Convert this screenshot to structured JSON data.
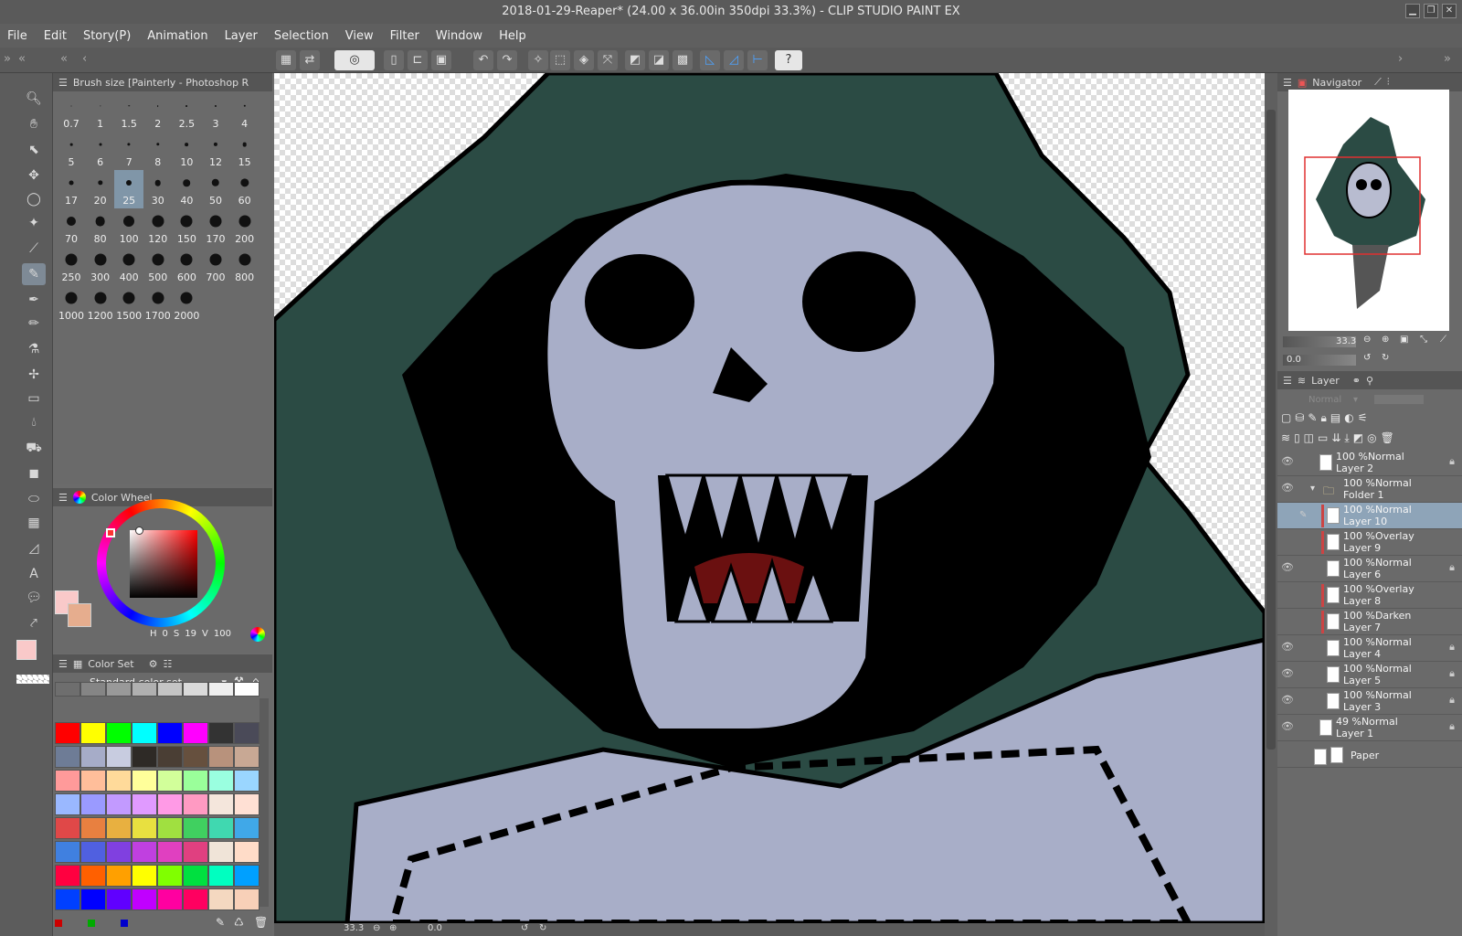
{
  "window": {
    "title": "2018-01-29-Reaper* (24.00 x 36.00in 350dpi 33.3%) - CLIP STUDIO PAINT EX"
  },
  "menu": [
    "File",
    "Edit",
    "Story(P)",
    "Animation",
    "Layer",
    "Selection",
    "View",
    "Filter",
    "Window",
    "Help"
  ],
  "subtool": {
    "header": "Brush size [Painterly - Photoshop R",
    "sizes": [
      "0.7",
      "1",
      "1.5",
      "2",
      "2.5",
      "3",
      "4",
      "5",
      "6",
      "7",
      "8",
      "10",
      "12",
      "15",
      "17",
      "20",
      "25",
      "30",
      "40",
      "50",
      "60",
      "70",
      "80",
      "100",
      "120",
      "150",
      "170",
      "200",
      "250",
      "300",
      "400",
      "500",
      "600",
      "700",
      "800",
      "1000",
      "1200",
      "1500",
      "1700",
      "2000"
    ],
    "selected": "25"
  },
  "color_wheel": {
    "title": "Color Wheel",
    "h_label": "H",
    "h": "0",
    "s_label": "S",
    "s": "19",
    "v_label": "V",
    "v": "100",
    "main_color": "#f9c9c9",
    "sub_color": "#e6ad8e"
  },
  "color_set": {
    "title": "Color Set",
    "set_name": "Standard color set",
    "swatches": [
      "#6e6e6e",
      "#858585",
      "#999999",
      "#b0b0b0",
      "#c4c4c4",
      "#dadada",
      "#eeeeee",
      "#ffffff",
      "#ff0000",
      "#ffff00",
      "#00ff00",
      "#00ffff",
      "#0000ff",
      "#ff00ff",
      "#333333",
      "#4a4a58",
      "#6e7c96",
      "#a6acc8",
      "#c8cce0",
      "#2e2a26",
      "#4a3e34",
      "#66503e",
      "#b8927c",
      "#c8a894",
      "#ff9a9a",
      "#ffbe9a",
      "#ffda9a",
      "#ffff9a",
      "#d2ff9a",
      "#9aff9a",
      "#9affe0",
      "#9ad6ff",
      "#9ab8ff",
      "#9a9aff",
      "#c29aff",
      "#e09aff",
      "#ff9ae6",
      "#ff9ac2",
      "#f4e6dc",
      "#ffe0d4",
      "#e04848",
      "#e88040",
      "#e8b040",
      "#e8e040",
      "#a0e040",
      "#40d060",
      "#40d8b0",
      "#40a8e8",
      "#4080e0",
      "#5060e0",
      "#8040e0",
      "#c040e0",
      "#e040c0",
      "#e04080",
      "#f0e4d8",
      "#ffdcc8",
      "#ff0040",
      "#ff6000",
      "#ffa000",
      "#ffff00",
      "#80ff00",
      "#00e040",
      "#00ffc0",
      "#00a0ff",
      "#0040ff",
      "#0000ff",
      "#6000ff",
      "#c000ff",
      "#ff00a0",
      "#ff0060",
      "#f4d8c0",
      "#f8d0b8"
    ]
  },
  "navigator": {
    "title": "Navigator",
    "zoom": "33.3",
    "rotation": "0.0"
  },
  "layer_panel": {
    "title": "Layer",
    "blend": "Normal",
    "layers": [
      {
        "opacity": "100 %Normal",
        "name": "Layer 2"
      },
      {
        "opacity": "100 %Normal",
        "name": "Folder 1"
      },
      {
        "opacity": "100 %Normal",
        "name": "Layer 10"
      },
      {
        "opacity": "100 %Overlay",
        "name": "Layer 9"
      },
      {
        "opacity": "100 %Normal",
        "name": "Layer 6"
      },
      {
        "opacity": "100 %Overlay",
        "name": "Layer 8"
      },
      {
        "opacity": "100 %Darken",
        "name": "Layer 7"
      },
      {
        "opacity": "100 %Normal",
        "name": "Layer 4"
      },
      {
        "opacity": "100 %Normal",
        "name": "Layer 5"
      },
      {
        "opacity": "100 %Normal",
        "name": "Layer 3"
      },
      {
        "opacity": "49 %Normal",
        "name": "Layer 1"
      },
      {
        "opacity": "",
        "name": "Paper"
      }
    ]
  },
  "status": {
    "zoom": "33.3",
    "angle": "0.0"
  }
}
